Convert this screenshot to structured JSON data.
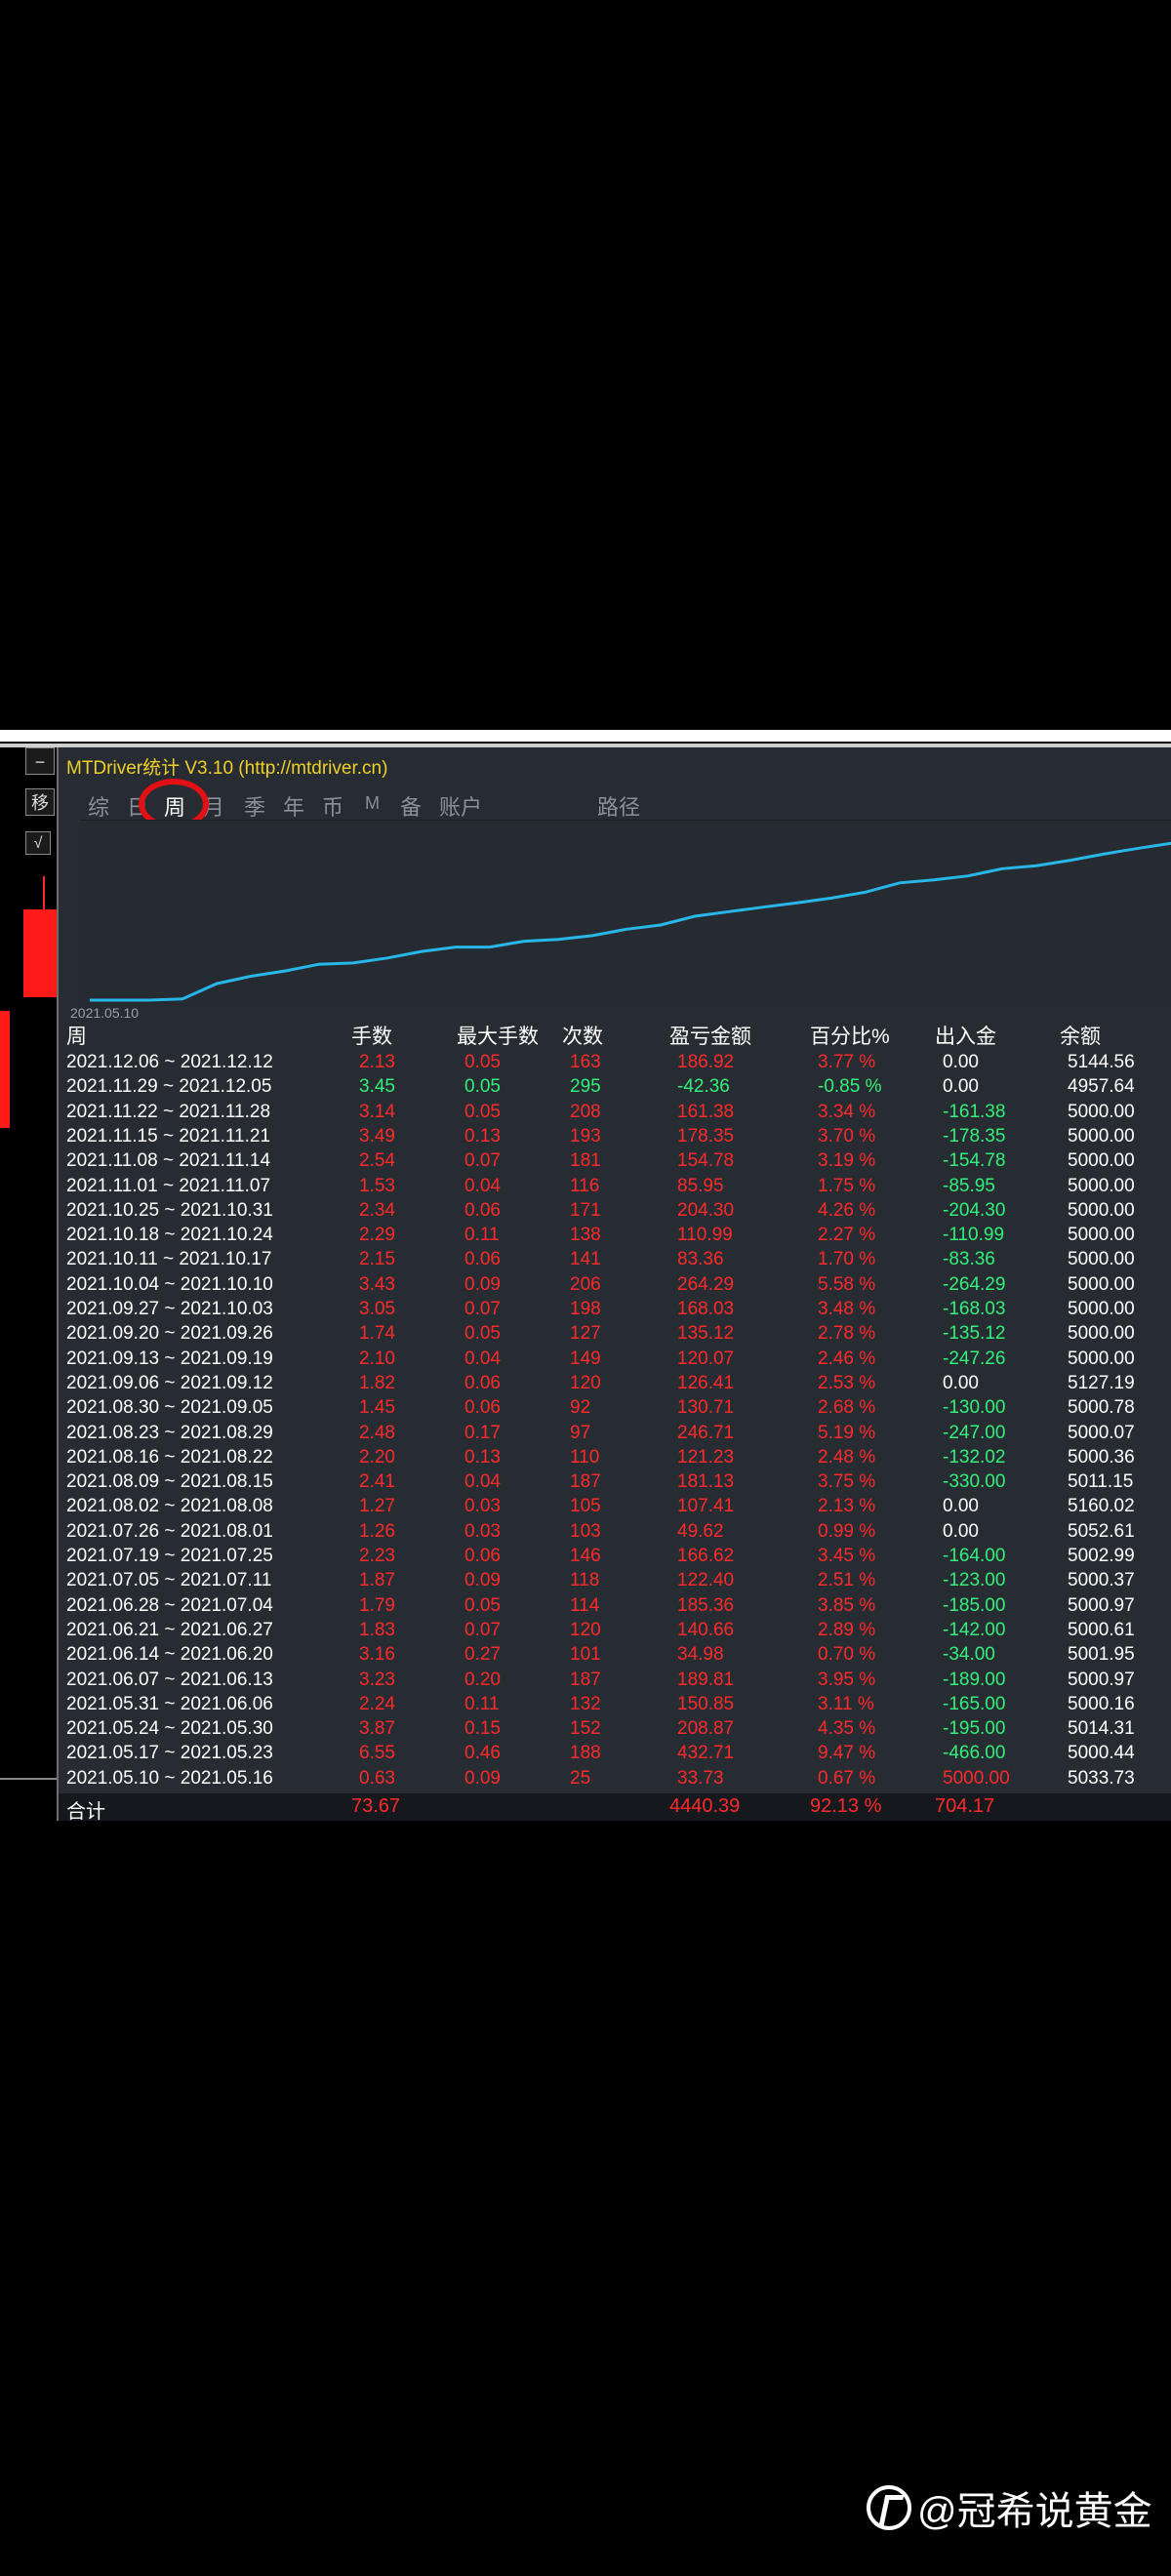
{
  "window": {
    "title": "MTDriver统计  V3.10 (http://mtdriver.cn)"
  },
  "left_buttons": [
    "−",
    "移",
    "√"
  ],
  "tabs": [
    {
      "label": "综",
      "active": false
    },
    {
      "label": "日",
      "active": false
    },
    {
      "label": "周",
      "active": true
    },
    {
      "label": "月",
      "active": false
    },
    {
      "label": "季",
      "active": false
    },
    {
      "label": "年",
      "active": false
    },
    {
      "label": "币",
      "active": false
    },
    {
      "label": "M",
      "active": false
    },
    {
      "label": "备",
      "active": false
    },
    {
      "label": "账户",
      "active": false
    },
    {
      "label": "路径",
      "active": false
    }
  ],
  "chart": {
    "start_date": "2021.05.10"
  },
  "chart_data": {
    "type": "line",
    "x": [
      "2021.05.10",
      "2021.05.17",
      "2021.05.24",
      "2021.05.31",
      "2021.06.07",
      "2021.06.14",
      "2021.06.21",
      "2021.06.28",
      "2021.07.05",
      "2021.07.12",
      "2021.07.19",
      "2021.07.26",
      "2021.08.02",
      "2021.08.09",
      "2021.08.16",
      "2021.08.23",
      "2021.08.30",
      "2021.09.06",
      "2021.09.13",
      "2021.09.20",
      "2021.09.27",
      "2021.10.04",
      "2021.10.11",
      "2021.10.18",
      "2021.10.25",
      "2021.11.01",
      "2021.11.08",
      "2021.11.15",
      "2021.11.22",
      "2021.11.29",
      "2021.12.06"
    ],
    "series": [
      {
        "values": [
          0,
          33.73,
          466.44,
          675.31,
          826.16,
          1015.97,
          1050.95,
          1191.61,
          1376.97,
          1499.37,
          1499.37,
          1665.99,
          1715.61,
          1823.02,
          2004.15,
          2125.48,
          2372.19,
          2503.1,
          2629.51,
          2749.58,
          2884.7,
          3052.73,
          3317.02,
          3400.38,
          3511.37,
          3715.67,
          3801.62,
          3956.4,
          4134.75,
          4296.13,
          4440.39
        ]
      }
    ],
    "ylim": [
      0,
      4800
    ]
  },
  "table": {
    "headers": [
      "周",
      "手数",
      "最大手数",
      "次数",
      "盈亏金额",
      "百分比%",
      "出入金",
      "余额"
    ],
    "rows": [
      {
        "week": "2021.12.06 ~ 2021.12.12",
        "lots": "2.13",
        "max": "0.05",
        "count": "163",
        "pnl": "186.92",
        "pct": "3.77 %",
        "flow": "0.00",
        "bal": "5144.56",
        "neg": false,
        "flow_color": "white"
      },
      {
        "week": "2021.11.29 ~ 2021.12.05",
        "lots": "3.45",
        "max": "0.05",
        "count": "295",
        "pnl": "-42.36",
        "pct": "-0.85 %",
        "flow": "0.00",
        "bal": "4957.64",
        "neg": true,
        "flow_color": "white"
      },
      {
        "week": "2021.11.22 ~ 2021.11.28",
        "lots": "3.14",
        "max": "0.05",
        "count": "208",
        "pnl": "161.38",
        "pct": "3.34 %",
        "flow": "-161.38",
        "bal": "5000.00",
        "neg": false,
        "flow_color": "green"
      },
      {
        "week": "2021.11.15 ~ 2021.11.21",
        "lots": "3.49",
        "max": "0.13",
        "count": "193",
        "pnl": "178.35",
        "pct": "3.70 %",
        "flow": "-178.35",
        "bal": "5000.00",
        "neg": false,
        "flow_color": "green"
      },
      {
        "week": "2021.11.08 ~ 2021.11.14",
        "lots": "2.54",
        "max": "0.07",
        "count": "181",
        "pnl": "154.78",
        "pct": "3.19 %",
        "flow": "-154.78",
        "bal": "5000.00",
        "neg": false,
        "flow_color": "green"
      },
      {
        "week": "2021.11.01 ~ 2021.11.07",
        "lots": "1.53",
        "max": "0.04",
        "count": "116",
        "pnl": "85.95",
        "pct": "1.75 %",
        "flow": "-85.95",
        "bal": "5000.00",
        "neg": false,
        "flow_color": "green"
      },
      {
        "week": "2021.10.25 ~ 2021.10.31",
        "lots": "2.34",
        "max": "0.06",
        "count": "171",
        "pnl": "204.30",
        "pct": "4.26 %",
        "flow": "-204.30",
        "bal": "5000.00",
        "neg": false,
        "flow_color": "green"
      },
      {
        "week": "2021.10.18 ~ 2021.10.24",
        "lots": "2.29",
        "max": "0.11",
        "count": "138",
        "pnl": "110.99",
        "pct": "2.27 %",
        "flow": "-110.99",
        "bal": "5000.00",
        "neg": false,
        "flow_color": "green"
      },
      {
        "week": "2021.10.11 ~ 2021.10.17",
        "lots": "2.15",
        "max": "0.06",
        "count": "141",
        "pnl": "83.36",
        "pct": "1.70 %",
        "flow": "-83.36",
        "bal": "5000.00",
        "neg": false,
        "flow_color": "green"
      },
      {
        "week": "2021.10.04 ~ 2021.10.10",
        "lots": "3.43",
        "max": "0.09",
        "count": "206",
        "pnl": "264.29",
        "pct": "5.58 %",
        "flow": "-264.29",
        "bal": "5000.00",
        "neg": false,
        "flow_color": "green"
      },
      {
        "week": "2021.09.27 ~ 2021.10.03",
        "lots": "3.05",
        "max": "0.07",
        "count": "198",
        "pnl": "168.03",
        "pct": "3.48 %",
        "flow": "-168.03",
        "bal": "5000.00",
        "neg": false,
        "flow_color": "green"
      },
      {
        "week": "2021.09.20 ~ 2021.09.26",
        "lots": "1.74",
        "max": "0.05",
        "count": "127",
        "pnl": "135.12",
        "pct": "2.78 %",
        "flow": "-135.12",
        "bal": "5000.00",
        "neg": false,
        "flow_color": "green"
      },
      {
        "week": "2021.09.13 ~ 2021.09.19",
        "lots": "2.10",
        "max": "0.04",
        "count": "149",
        "pnl": "120.07",
        "pct": "2.46 %",
        "flow": "-247.26",
        "bal": "5000.00",
        "neg": false,
        "flow_color": "green"
      },
      {
        "week": "2021.09.06 ~ 2021.09.12",
        "lots": "1.82",
        "max": "0.06",
        "count": "120",
        "pnl": "126.41",
        "pct": "2.53 %",
        "flow": "0.00",
        "bal": "5127.19",
        "neg": false,
        "flow_color": "white"
      },
      {
        "week": "2021.08.30 ~ 2021.09.05",
        "lots": "1.45",
        "max": "0.06",
        "count": "92",
        "pnl": "130.71",
        "pct": "2.68 %",
        "flow": "-130.00",
        "bal": "5000.78",
        "neg": false,
        "flow_color": "green"
      },
      {
        "week": "2021.08.23 ~ 2021.08.29",
        "lots": "2.48",
        "max": "0.17",
        "count": "97",
        "pnl": "246.71",
        "pct": "5.19 %",
        "flow": "-247.00",
        "bal": "5000.07",
        "neg": false,
        "flow_color": "green"
      },
      {
        "week": "2021.08.16 ~ 2021.08.22",
        "lots": "2.20",
        "max": "0.13",
        "count": "110",
        "pnl": "121.23",
        "pct": "2.48 %",
        "flow": "-132.02",
        "bal": "5000.36",
        "neg": false,
        "flow_color": "green"
      },
      {
        "week": "2021.08.09 ~ 2021.08.15",
        "lots": "2.41",
        "max": "0.04",
        "count": "187",
        "pnl": "181.13",
        "pct": "3.75 %",
        "flow": "-330.00",
        "bal": "5011.15",
        "neg": false,
        "flow_color": "green"
      },
      {
        "week": "2021.08.02 ~ 2021.08.08",
        "lots": "1.27",
        "max": "0.03",
        "count": "105",
        "pnl": "107.41",
        "pct": "2.13 %",
        "flow": "0.00",
        "bal": "5160.02",
        "neg": false,
        "flow_color": "white"
      },
      {
        "week": "2021.07.26 ~ 2021.08.01",
        "lots": "1.26",
        "max": "0.03",
        "count": "103",
        "pnl": "49.62",
        "pct": "0.99 %",
        "flow": "0.00",
        "bal": "5052.61",
        "neg": false,
        "flow_color": "white"
      },
      {
        "week": "2021.07.19 ~ 2021.07.25",
        "lots": "2.23",
        "max": "0.06",
        "count": "146",
        "pnl": "166.62",
        "pct": "3.45 %",
        "flow": "-164.00",
        "bal": "5002.99",
        "neg": false,
        "flow_color": "green"
      },
      {
        "week": "2021.07.05 ~ 2021.07.11",
        "lots": "1.87",
        "max": "0.09",
        "count": "118",
        "pnl": "122.40",
        "pct": "2.51 %",
        "flow": "-123.00",
        "bal": "5000.37",
        "neg": false,
        "flow_color": "green"
      },
      {
        "week": "2021.06.28 ~ 2021.07.04",
        "lots": "1.79",
        "max": "0.05",
        "count": "114",
        "pnl": "185.36",
        "pct": "3.85 %",
        "flow": "-185.00",
        "bal": "5000.97",
        "neg": false,
        "flow_color": "green"
      },
      {
        "week": "2021.06.21 ~ 2021.06.27",
        "lots": "1.83",
        "max": "0.07",
        "count": "120",
        "pnl": "140.66",
        "pct": "2.89 %",
        "flow": "-142.00",
        "bal": "5000.61",
        "neg": false,
        "flow_color": "green"
      },
      {
        "week": "2021.06.14 ~ 2021.06.20",
        "lots": "3.16",
        "max": "0.27",
        "count": "101",
        "pnl": "34.98",
        "pct": "0.70 %",
        "flow": "-34.00",
        "bal": "5001.95",
        "neg": false,
        "flow_color": "green"
      },
      {
        "week": "2021.06.07 ~ 2021.06.13",
        "lots": "3.23",
        "max": "0.20",
        "count": "187",
        "pnl": "189.81",
        "pct": "3.95 %",
        "flow": "-189.00",
        "bal": "5000.97",
        "neg": false,
        "flow_color": "green"
      },
      {
        "week": "2021.05.31 ~ 2021.06.06",
        "lots": "2.24",
        "max": "0.11",
        "count": "132",
        "pnl": "150.85",
        "pct": "3.11 %",
        "flow": "-165.00",
        "bal": "5000.16",
        "neg": false,
        "flow_color": "green"
      },
      {
        "week": "2021.05.24 ~ 2021.05.30",
        "lots": "3.87",
        "max": "0.15",
        "count": "152",
        "pnl": "208.87",
        "pct": "4.35 %",
        "flow": "-195.00",
        "bal": "5014.31",
        "neg": false,
        "flow_color": "green"
      },
      {
        "week": "2021.05.17 ~ 2021.05.23",
        "lots": "6.55",
        "max": "0.46",
        "count": "188",
        "pnl": "432.71",
        "pct": "9.47 %",
        "flow": "-466.00",
        "bal": "5000.44",
        "neg": false,
        "flow_color": "green"
      },
      {
        "week": "2021.05.10 ~ 2021.05.16",
        "lots": "0.63",
        "max": "0.09",
        "count": "25",
        "pnl": "33.73",
        "pct": "0.67 %",
        "flow": "5000.00",
        "bal": "5033.73",
        "neg": false,
        "flow_color": "red"
      }
    ],
    "totals": {
      "label": "合计",
      "lots": "73.67",
      "pnl": "4440.39",
      "pct": "92.13 %",
      "flow": "704.17"
    }
  },
  "watermark": {
    "text": "@冠希说黄金",
    "icon": "toutiao-logo-icon"
  },
  "colors": {
    "positive": "#ff2a2a",
    "negative": "#32f07a",
    "line": "#29b6e8",
    "title": "#f0d027"
  }
}
